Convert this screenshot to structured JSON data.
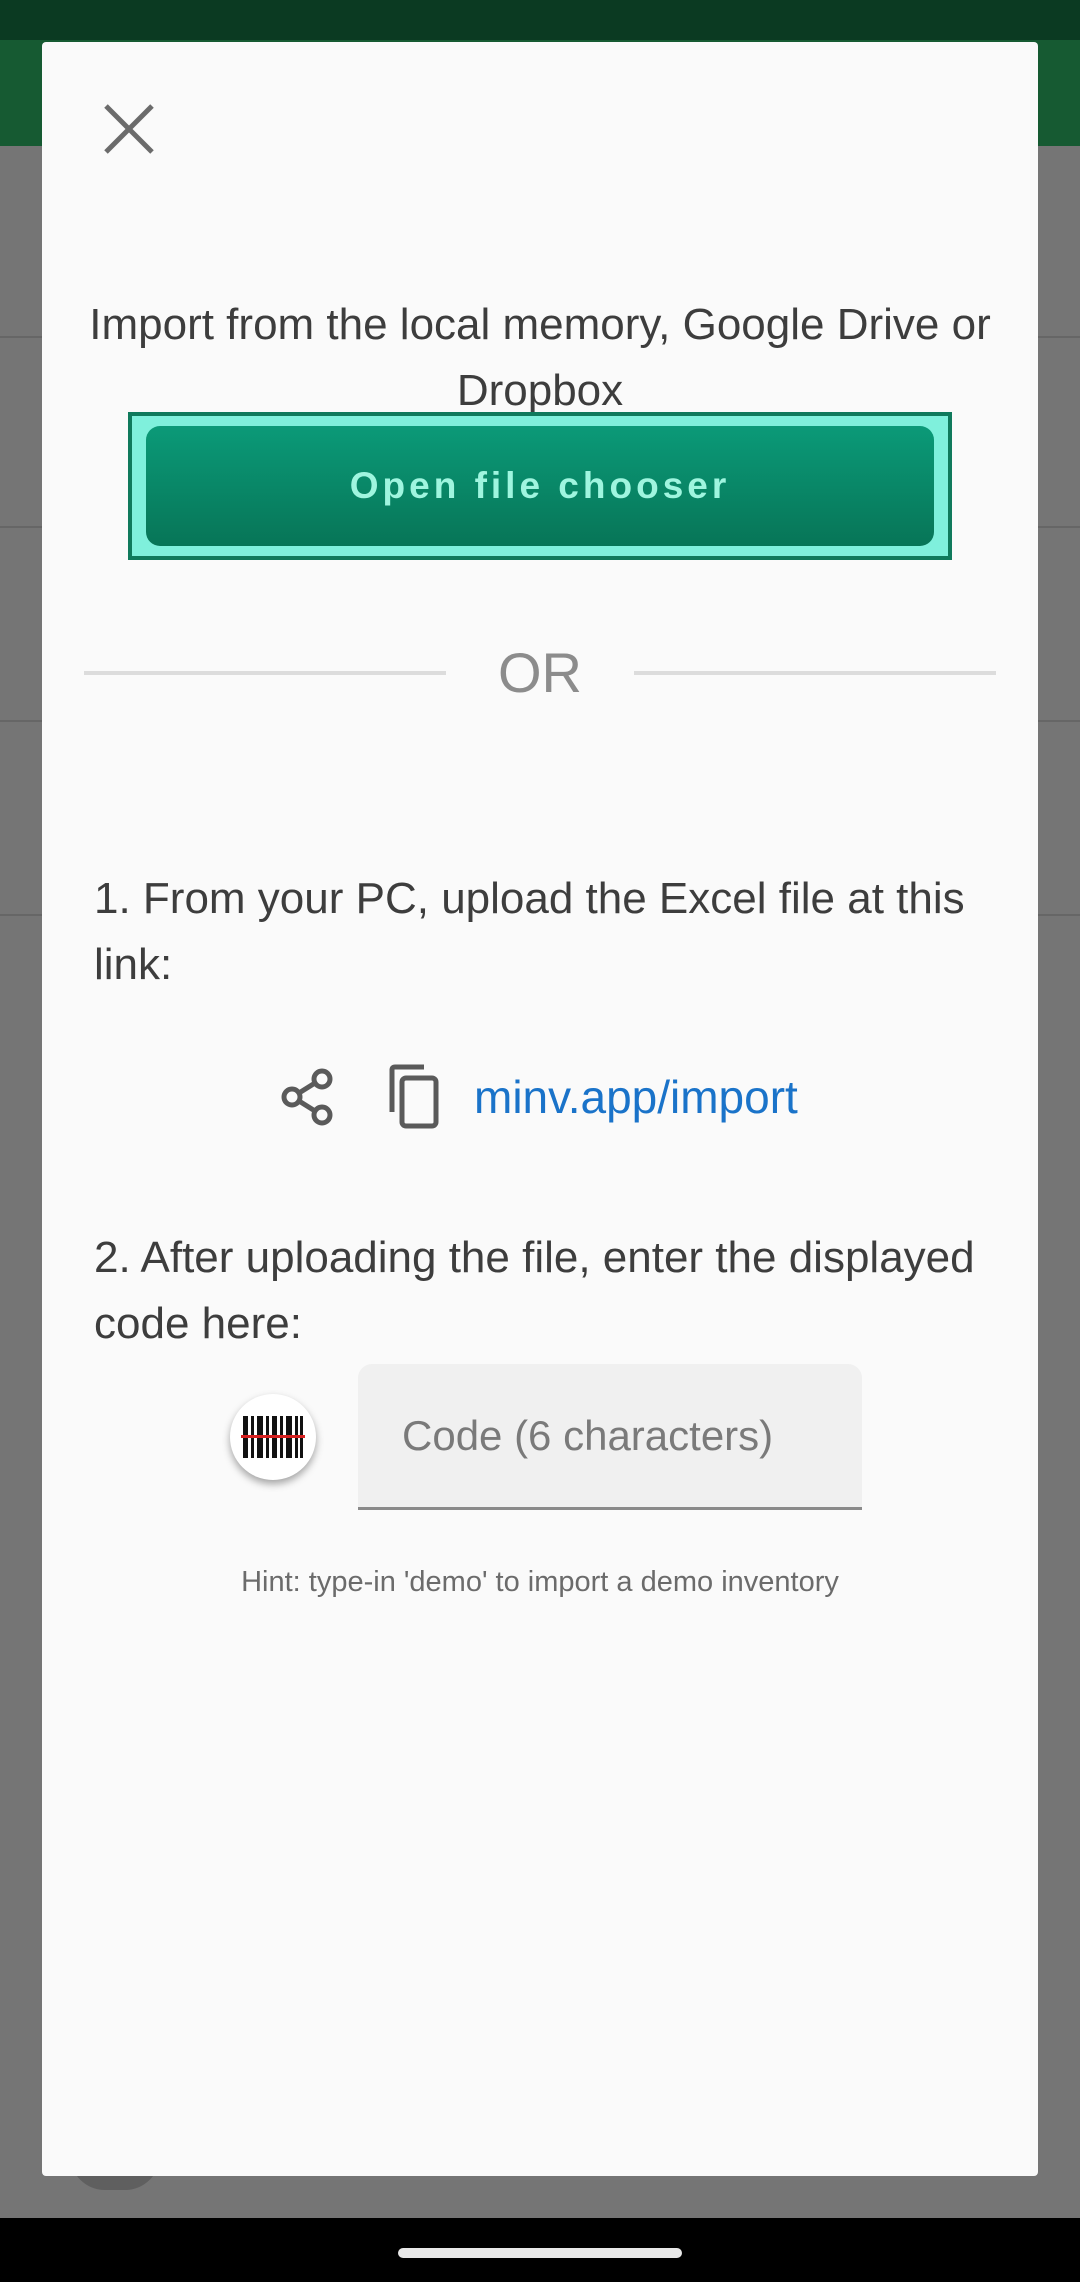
{
  "dialog": {
    "intro_text": "Import from the local memory, Google Drive or Dropbox",
    "open_file_chooser_label": "Open file chooser",
    "or_label": "OR",
    "step1_text": "1. From your PC, upload the Excel file at this link:",
    "link_text": "minv.app/import",
    "step2_text": "2. After uploading the file, enter the displayed code here:",
    "code_placeholder": "Code (6 characters)",
    "code_value": "",
    "hint_text": "Hint: type-in 'demo' to import a demo inventory"
  },
  "icons": {
    "close": "close-icon",
    "share": "share-icon",
    "copy": "copy-icon",
    "barcode": "barcode-scan-icon"
  },
  "colors": {
    "app_toolbar": "#165a32",
    "button_fill": "#0b9a78",
    "button_text": "#9ff5df",
    "button_focus_border": "#7ff0dc",
    "link": "#1a73c9"
  }
}
